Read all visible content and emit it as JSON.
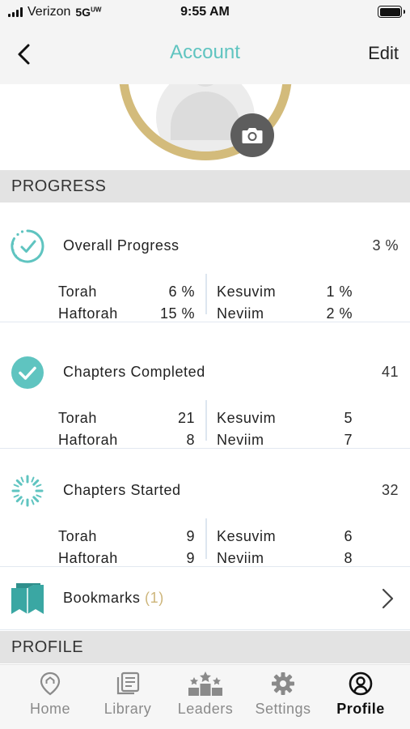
{
  "status_bar": {
    "carrier": "Verizon",
    "network": "5G",
    "network_suffix": "UW",
    "time": "9:55 AM"
  },
  "nav": {
    "title": "Account",
    "edit_label": "Edit",
    "title_color": "#5fc4c0"
  },
  "progress_section": {
    "header": "PROGRESS",
    "overall": {
      "title": "Overall Progress",
      "total": "3 %",
      "cells": [
        {
          "label": "Torah",
          "value": "6 %"
        },
        {
          "label": "Kesuvim",
          "value": "1 %"
        },
        {
          "label": "Haftorah",
          "value": "15 %"
        },
        {
          "label": "Neviim",
          "value": "2 %"
        }
      ]
    },
    "completed": {
      "title": "Chapters Completed",
      "total": "41",
      "cells": [
        {
          "label": "Torah",
          "value": "21"
        },
        {
          "label": "Kesuvim",
          "value": "5"
        },
        {
          "label": "Haftorah",
          "value": "8"
        },
        {
          "label": "Neviim",
          "value": "7"
        }
      ]
    },
    "started": {
      "title": "Chapters Started",
      "total": "32",
      "cells": [
        {
          "label": "Torah",
          "value": "9"
        },
        {
          "label": "Kesuvim",
          "value": "6"
        },
        {
          "label": "Haftorah",
          "value": "9"
        },
        {
          "label": "Neviim",
          "value": "8"
        }
      ]
    },
    "bookmarks": {
      "label": "Bookmarks",
      "count": "(1)"
    }
  },
  "profile_section": {
    "header": "PROFILE"
  },
  "tabs": [
    {
      "label": "Home",
      "icon": "home-pin-icon",
      "active": false
    },
    {
      "label": "Library",
      "icon": "library-icon",
      "active": false
    },
    {
      "label": "Leaders",
      "icon": "leaders-podium-icon",
      "active": false
    },
    {
      "label": "Settings",
      "icon": "gear-icon",
      "active": false
    },
    {
      "label": "Profile",
      "icon": "profile-icon",
      "active": true
    }
  ],
  "colors": {
    "accent_teal": "#5fc4c0",
    "avatar_ring_gold": "#d3bb7b",
    "section_header_bg": "#e3e3e3"
  }
}
